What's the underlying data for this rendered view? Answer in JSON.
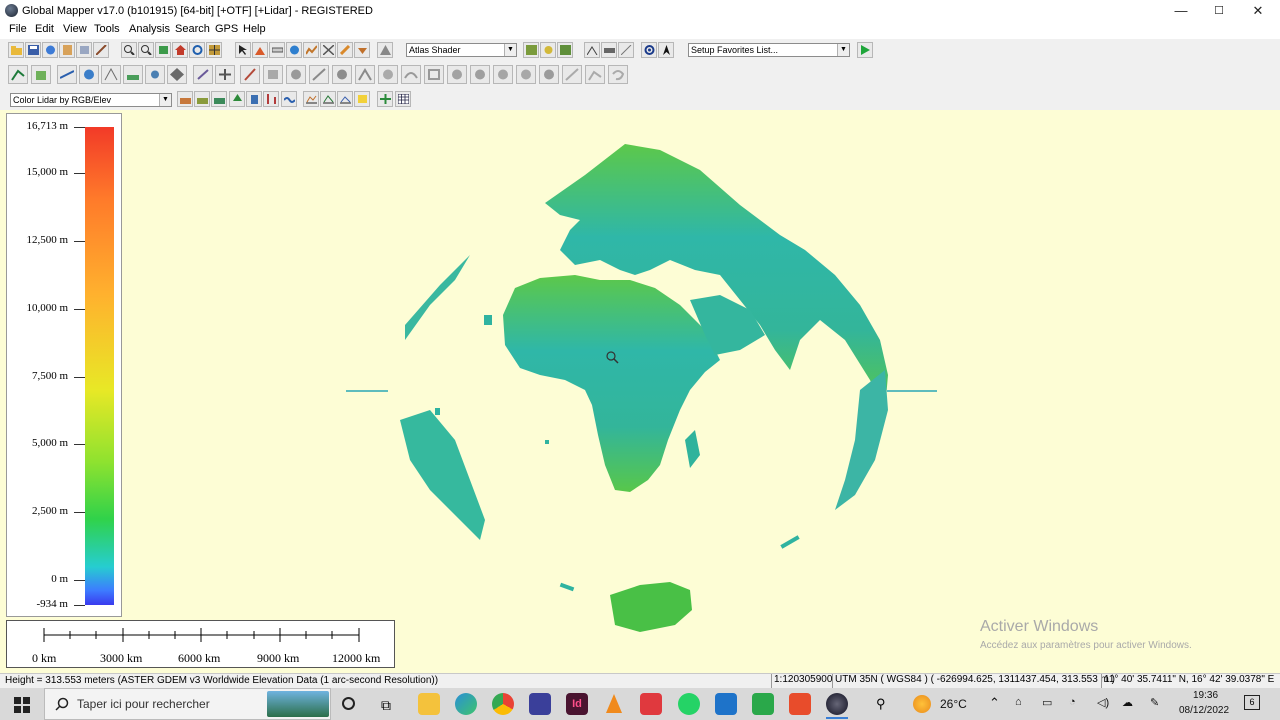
{
  "window": {
    "title": "Global Mapper v17.0 (b101915) [64-bit] [+OTF] [+Lidar] - REGISTERED",
    "controls": {
      "minimize": "—",
      "maximize": "☐",
      "close": "✕"
    }
  },
  "menu": [
    "File",
    "Edit",
    "View",
    "Tools",
    "Analysis",
    "Search",
    "GPS",
    "Help"
  ],
  "toolbar": {
    "shader_select": "Atlas Shader",
    "favorites_select": "Setup Favorites List...",
    "lidar_color_select": "Color Lidar by RGB/Elev"
  },
  "legend": {
    "labels": [
      "16,713 m",
      "15,000 m",
      "12,500 m",
      "10,000 m",
      "7,500 m",
      "5,000 m",
      "2,500 m",
      "0 m",
      "-934 m"
    ],
    "colors": {
      "max": "#f23a28",
      "high": "#ffb12e",
      "mid": "#e8e826",
      "low": "#30d24a",
      "sea": "#26cdd0",
      "min": "#3a3aee"
    }
  },
  "scale_bar": {
    "labels": [
      "0 km",
      "3000 km",
      "6000 km",
      "9000 km",
      "12000 km"
    ]
  },
  "watermark": {
    "title": "Activer Windows",
    "subtitle": "Accédez aux paramètres pour activer Windows."
  },
  "status": {
    "left": "Height = 313.553 meters (ASTER GDEM v3 Worldwide Elevation Data (1 arc-second Resolution))",
    "scale": "1:120305900",
    "coords": "UTM 35N ( WGS84 ) ( -626994.625, 1311437.454, 313.553 m )",
    "latlon": "11° 40' 35.7411\" N, 16° 42' 39.0378\" E"
  },
  "taskbar": {
    "search_placeholder": "Taper ici pour rechercher",
    "temperature": "26°C",
    "time": "19:36",
    "date": "08/12/2022",
    "notification_count": "6"
  },
  "map_colors": {
    "background": "#fdfdd5",
    "land": "#2fbfa2"
  }
}
